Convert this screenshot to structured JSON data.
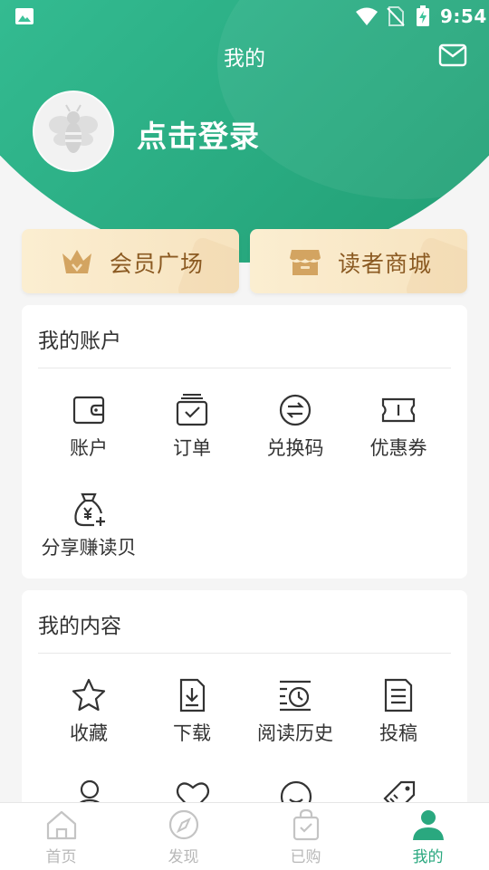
{
  "status_bar": {
    "time": "9:54"
  },
  "header": {
    "title": "我的",
    "login_text": "点击登录"
  },
  "promos": [
    {
      "label": "会员广场",
      "icon": "crown-icon"
    },
    {
      "label": "读者商城",
      "icon": "store-icon"
    }
  ],
  "account": {
    "title": "我的账户",
    "items": [
      {
        "label": "账户",
        "icon": "wallet-icon"
      },
      {
        "label": "订单",
        "icon": "order-icon"
      },
      {
        "label": "兑换码",
        "icon": "exchange-icon"
      },
      {
        "label": "优惠券",
        "icon": "coupon-icon"
      },
      {
        "label": "分享赚读贝",
        "icon": "money-bag-icon"
      }
    ]
  },
  "content": {
    "title": "我的内容",
    "items": [
      {
        "label": "收藏",
        "icon": "star-icon"
      },
      {
        "label": "下载",
        "icon": "download-icon"
      },
      {
        "label": "阅读历史",
        "icon": "history-icon"
      },
      {
        "label": "投稿",
        "icon": "document-icon"
      }
    ]
  },
  "tabs": [
    {
      "label": "首页",
      "icon": "home-icon"
    },
    {
      "label": "发现",
      "icon": "compass-icon"
    },
    {
      "label": "已购",
      "icon": "purchased-bag-icon"
    },
    {
      "label": "我的",
      "icon": "person-icon",
      "active": true
    }
  ],
  "colors": {
    "brand": "#2aa87f",
    "header_light": "#4fd8ad",
    "header_dark": "#1f9a70",
    "promo_bg": "#f9e9c9",
    "promo_text": "#8b5a22",
    "tab_inactive": "#b8b8b8"
  }
}
